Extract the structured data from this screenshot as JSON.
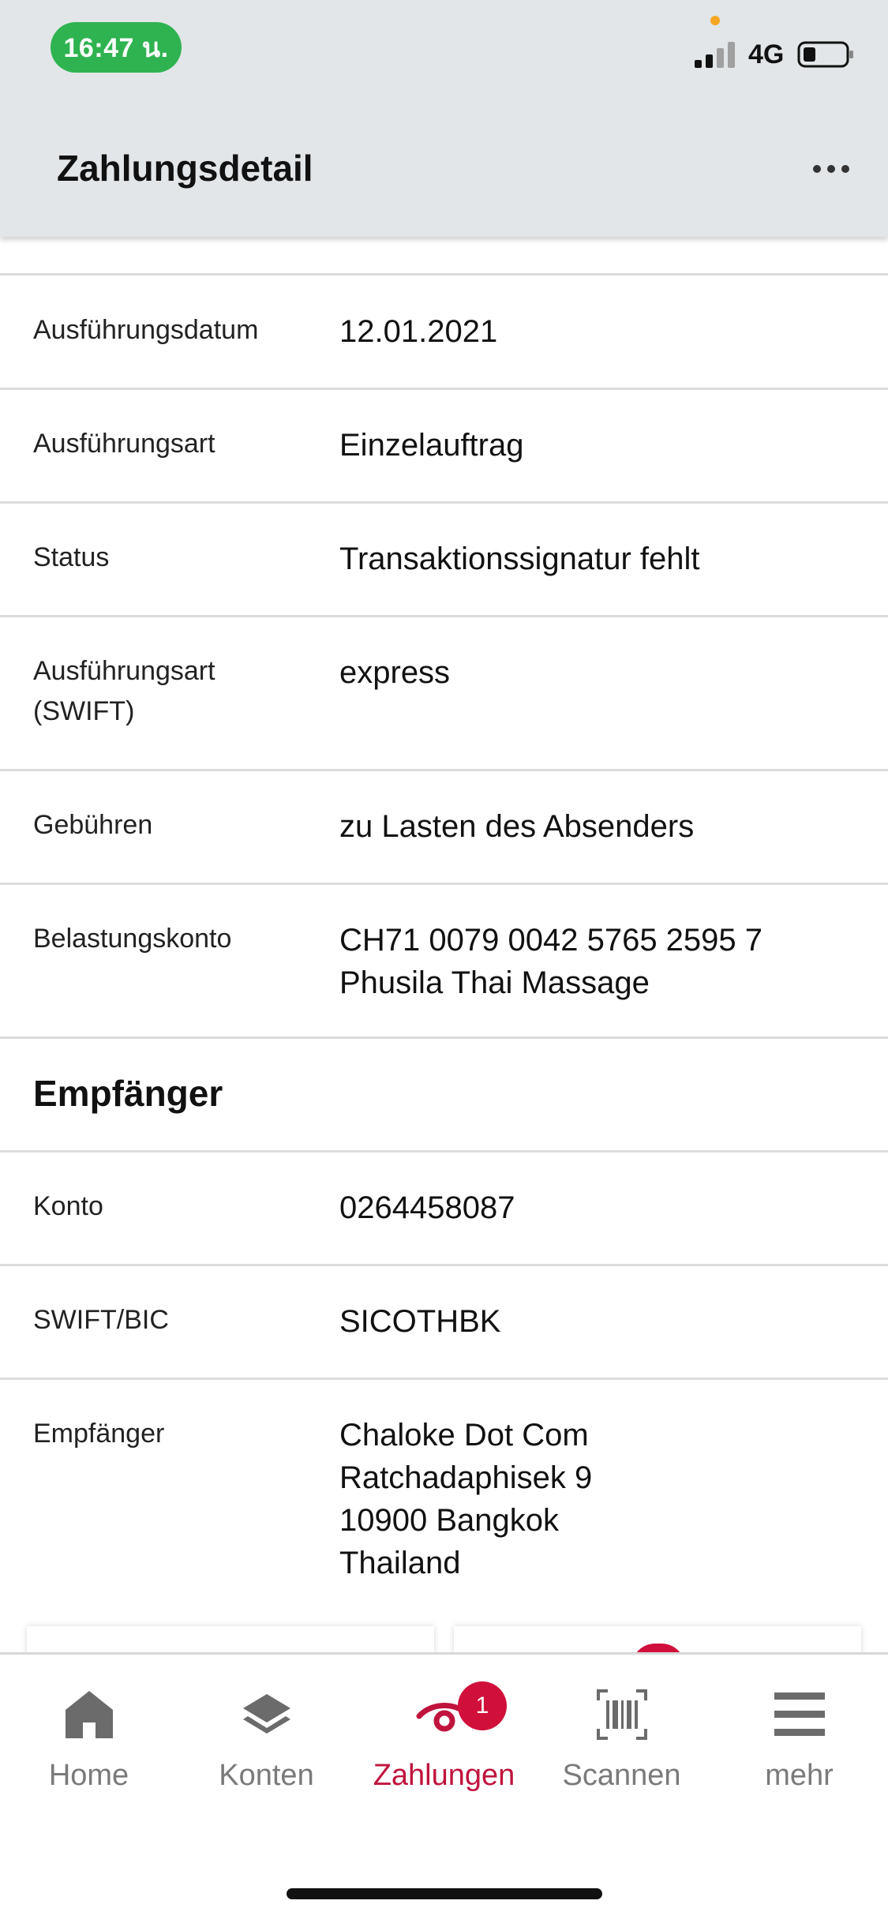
{
  "status_bar": {
    "time": "16:47 น.",
    "network": "4G"
  },
  "header": {
    "title": "Zahlungsdetail"
  },
  "rows": [
    {
      "label": "Ausführungsdatum",
      "value": "12.01.2021"
    },
    {
      "label": "Ausführungsart",
      "value": "Einzelauftrag"
    },
    {
      "label": "Status",
      "value": "Transaktionssignatur fehlt"
    },
    {
      "label": "Ausführungsart\n(SWIFT)",
      "value": "express"
    },
    {
      "label": "Gebühren",
      "value": "zu Lasten des Absenders"
    },
    {
      "label": "Belastungskonto",
      "value": "CH71 0079 0042 5765 2595 7\nPhusila Thai Massage"
    }
  ],
  "recipient_section": {
    "title": "Empfänger",
    "rows": [
      {
        "label": "Konto",
        "value": "0264458087"
      },
      {
        "label": "SWIFT/BIC",
        "value": "SICOTHBK"
      },
      {
        "label": "Empfänger",
        "value": "Chaloke Dot Com\nRatchadaphisek 9\n10900 Bangkok\nThailand"
      }
    ]
  },
  "tabbar": {
    "items": [
      {
        "label": "Home",
        "icon": "home-icon"
      },
      {
        "label": "Konten",
        "icon": "layers-icon"
      },
      {
        "label": "Zahlungen",
        "icon": "payments-icon",
        "active": true,
        "badge": "1"
      },
      {
        "label": "Scannen",
        "icon": "barcode-scan-icon"
      },
      {
        "label": "mehr",
        "icon": "menu-icon"
      }
    ]
  },
  "colors": {
    "accent": "#c0143c",
    "header_bg": "#e2e6e8",
    "status_green": "#2fb350"
  }
}
